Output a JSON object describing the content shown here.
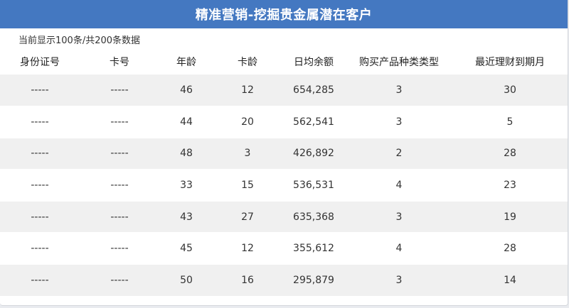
{
  "title": "精准营销-挖掘贵金属潜在客户",
  "record_info": "当前显示100条/共200条数据",
  "colors": {
    "title_bar": "#4478c1",
    "row_stripe": "#f0f0f0"
  },
  "table": {
    "columns": [
      "身份证号",
      "卡号",
      "年龄",
      "卡龄",
      "日均余额",
      "购买产品种类类型",
      "最近理财到期月"
    ],
    "rows": [
      [
        "-----",
        "-----",
        "46",
        "12",
        "654,285",
        "3",
        "30"
      ],
      [
        "-----",
        "-----",
        "44",
        "20",
        "562,541",
        "3",
        "5"
      ],
      [
        "-----",
        "-----",
        "48",
        "3",
        "426,892",
        "2",
        "28"
      ],
      [
        "-----",
        "-----",
        "33",
        "15",
        "536,531",
        "4",
        "23"
      ],
      [
        "-----",
        "-----",
        "43",
        "27",
        "635,368",
        "3",
        "19"
      ],
      [
        "-----",
        "-----",
        "45",
        "12",
        "355,612",
        "4",
        "28"
      ],
      [
        "-----",
        "-----",
        "50",
        "16",
        "295,879",
        "3",
        "14"
      ]
    ]
  }
}
